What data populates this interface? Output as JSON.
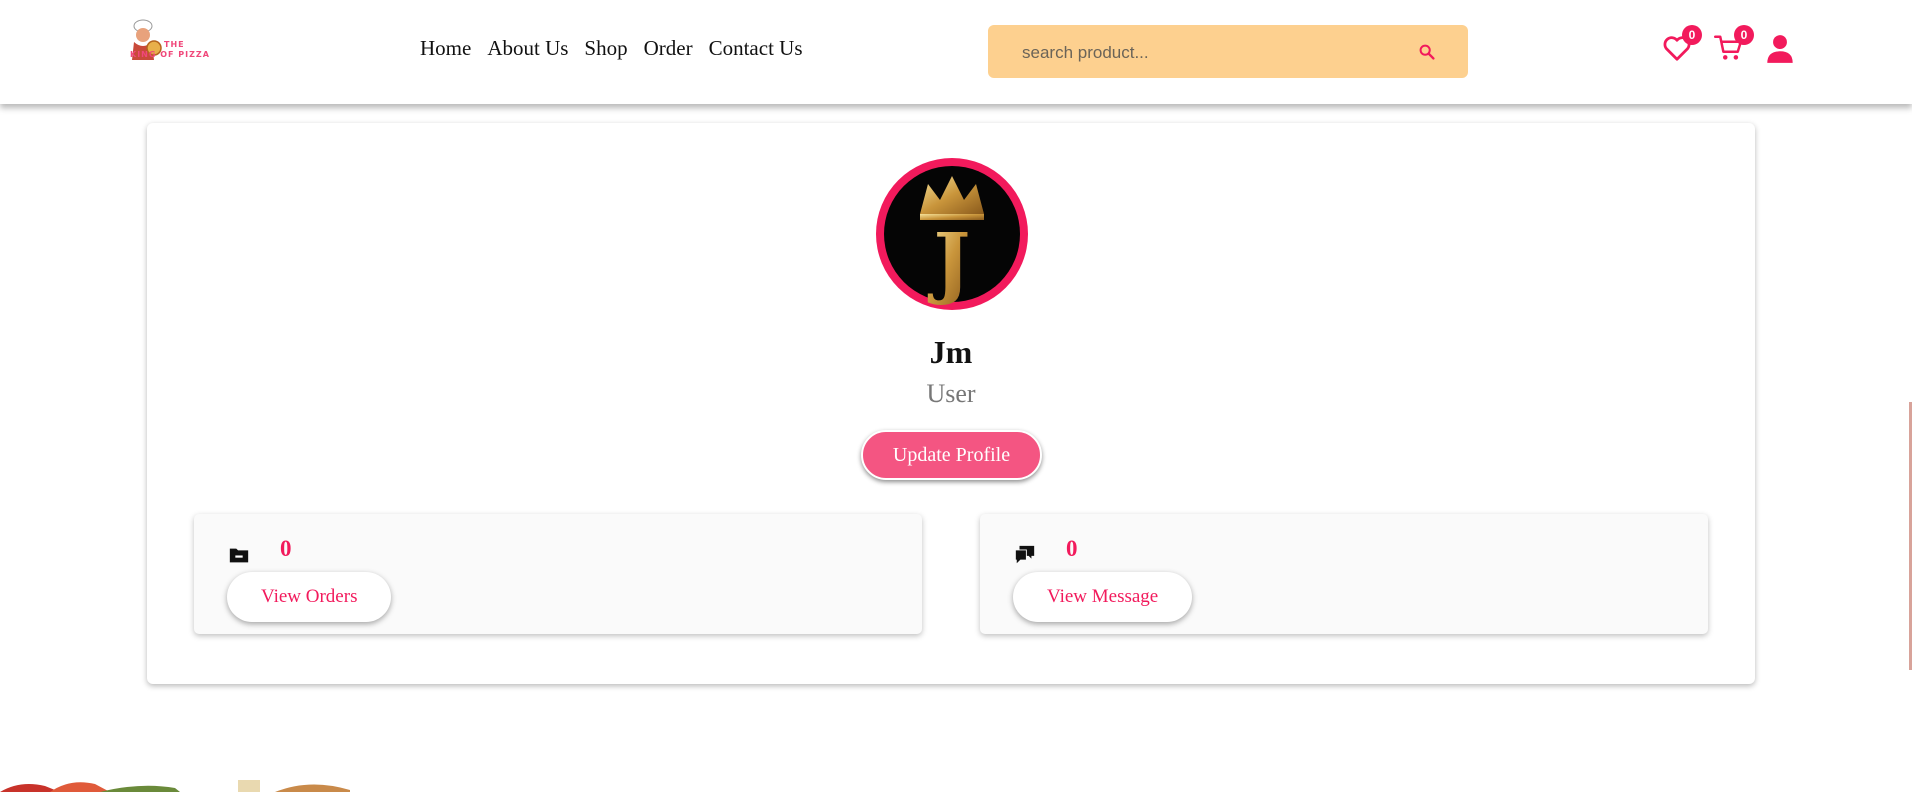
{
  "header": {
    "logo_alt": "The King of Pizza",
    "logo_line1": "THE",
    "logo_line2": "KING OF PIZZA",
    "nav": [
      "Home",
      "About Us",
      "Shop",
      "Order",
      "Contact Us"
    ],
    "search_placeholder": "search product...",
    "wishlist_count": "0",
    "cart_count": "0",
    "icons": [
      "heart-icon",
      "cart-icon",
      "user-icon",
      "search-icon"
    ]
  },
  "profile": {
    "avatar_letter": "J",
    "name": "Jm",
    "role": "User",
    "update_label": "Update Profile"
  },
  "stats": [
    {
      "icon": "folder-icon",
      "count": "0",
      "button": "View Orders"
    },
    {
      "icon": "chat-icon",
      "count": "0",
      "button": "View Message"
    }
  ],
  "colors": {
    "accent": "#f21a5c",
    "search_bg": "#fdd08f",
    "button_bg": "#f45582"
  }
}
